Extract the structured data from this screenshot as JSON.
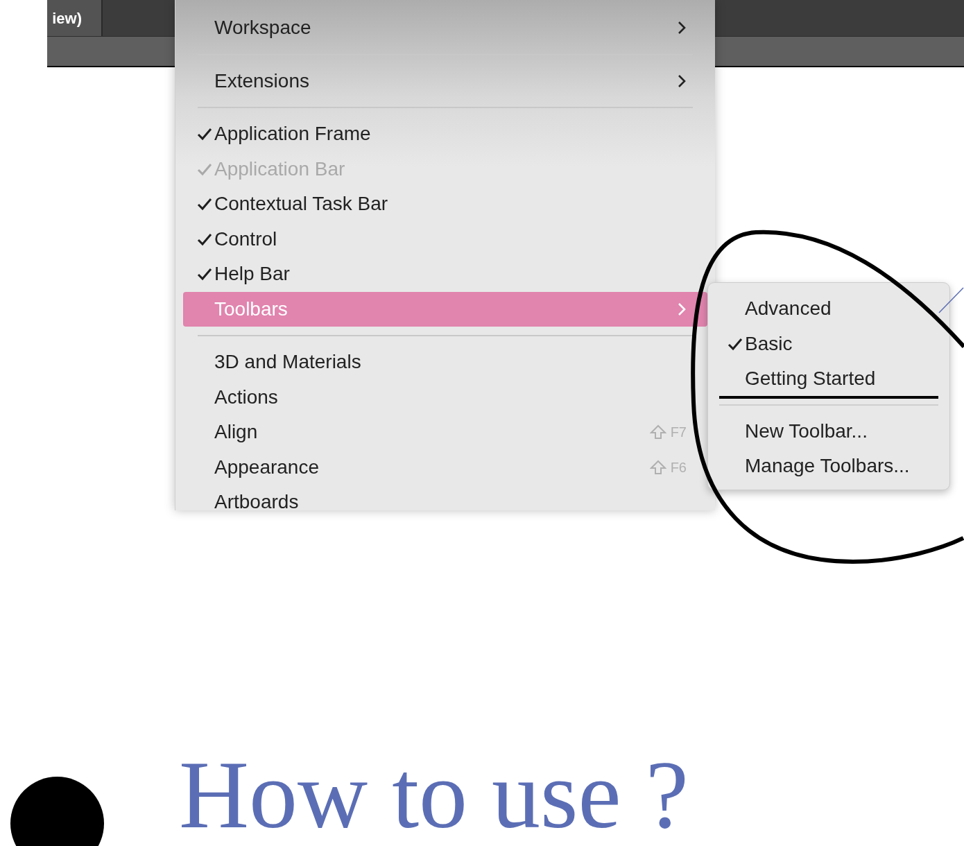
{
  "app_bar": {
    "tab_label": "iew)"
  },
  "menu": {
    "items": [
      {
        "kind": "item",
        "label": "Workspace",
        "checked": false,
        "disabled": false,
        "selected": false,
        "submenu": true
      },
      {
        "kind": "separator"
      },
      {
        "kind": "item",
        "label": "Extensions",
        "checked": false,
        "disabled": false,
        "selected": false,
        "submenu": true
      },
      {
        "kind": "separator"
      },
      {
        "kind": "item",
        "label": "Application Frame",
        "checked": true,
        "disabled": false,
        "selected": false,
        "submenu": false
      },
      {
        "kind": "item",
        "label": "Application Bar",
        "checked": true,
        "disabled": true,
        "selected": false,
        "submenu": false
      },
      {
        "kind": "item",
        "label": "Contextual Task Bar",
        "checked": true,
        "disabled": false,
        "selected": false,
        "submenu": false
      },
      {
        "kind": "item",
        "label": "Control",
        "checked": true,
        "disabled": false,
        "selected": false,
        "submenu": false
      },
      {
        "kind": "item",
        "label": "Help Bar",
        "checked": true,
        "disabled": false,
        "selected": false,
        "submenu": false
      },
      {
        "kind": "item",
        "label": "Toolbars",
        "checked": false,
        "disabled": false,
        "selected": true,
        "submenu": true
      },
      {
        "kind": "separator"
      },
      {
        "kind": "item",
        "label": "3D and Materials",
        "checked": false,
        "disabled": false,
        "selected": false,
        "submenu": false
      },
      {
        "kind": "item",
        "label": "Actions",
        "checked": false,
        "disabled": false,
        "selected": false,
        "submenu": false
      },
      {
        "kind": "item",
        "label": "Align",
        "checked": false,
        "disabled": false,
        "selected": false,
        "submenu": false,
        "shortcut": "F7"
      },
      {
        "kind": "item",
        "label": "Appearance",
        "checked": false,
        "disabled": false,
        "selected": false,
        "submenu": false,
        "shortcut": "F6"
      },
      {
        "kind": "item",
        "label": "Artboards",
        "checked": false,
        "disabled": false,
        "selected": false,
        "submenu": false
      }
    ]
  },
  "submenu": {
    "items": [
      {
        "kind": "item",
        "label": "Advanced",
        "checked": false,
        "underlined": false
      },
      {
        "kind": "item",
        "label": "Basic",
        "checked": true,
        "underlined": false
      },
      {
        "kind": "item",
        "label": "Getting Started",
        "checked": false,
        "underlined": true
      },
      {
        "kind": "separator"
      },
      {
        "kind": "item",
        "label": "New Toolbar...",
        "checked": false,
        "underlined": false
      },
      {
        "kind": "item",
        "label": "Manage Toolbars...",
        "checked": false,
        "underlined": false
      }
    ]
  },
  "heading": "How to use ?"
}
